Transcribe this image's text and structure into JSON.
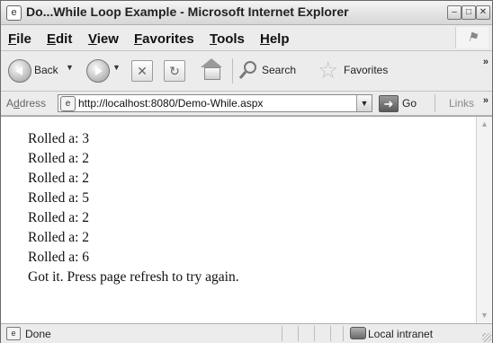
{
  "window": {
    "title": "Do...While Loop Example - Microsoft Internet Explorer",
    "title_icon": "ie-icon",
    "controls": [
      "minimize",
      "maximize",
      "close"
    ]
  },
  "menu": {
    "items": [
      {
        "label": "File"
      },
      {
        "label": "Edit"
      },
      {
        "label": "View"
      },
      {
        "label": "Favorites"
      },
      {
        "label": "Tools"
      },
      {
        "label": "Help"
      }
    ]
  },
  "toolbar": {
    "back_label": "Back",
    "search_label": "Search",
    "favorites_label": "Favorites"
  },
  "address": {
    "label": "Address",
    "url": "http://localhost:8080/Demo-While.aspx",
    "go_label": "Go",
    "links_label": "Links"
  },
  "content": {
    "lines": [
      "Rolled a: 3",
      "Rolled a: 2",
      "Rolled a: 2",
      "Rolled a: 5",
      "Rolled a: 2",
      "Rolled a: 2",
      "Rolled a: 6",
      "Got it. Press page refresh to try again."
    ]
  },
  "status": {
    "text": "Done",
    "zone": "Local intranet"
  }
}
